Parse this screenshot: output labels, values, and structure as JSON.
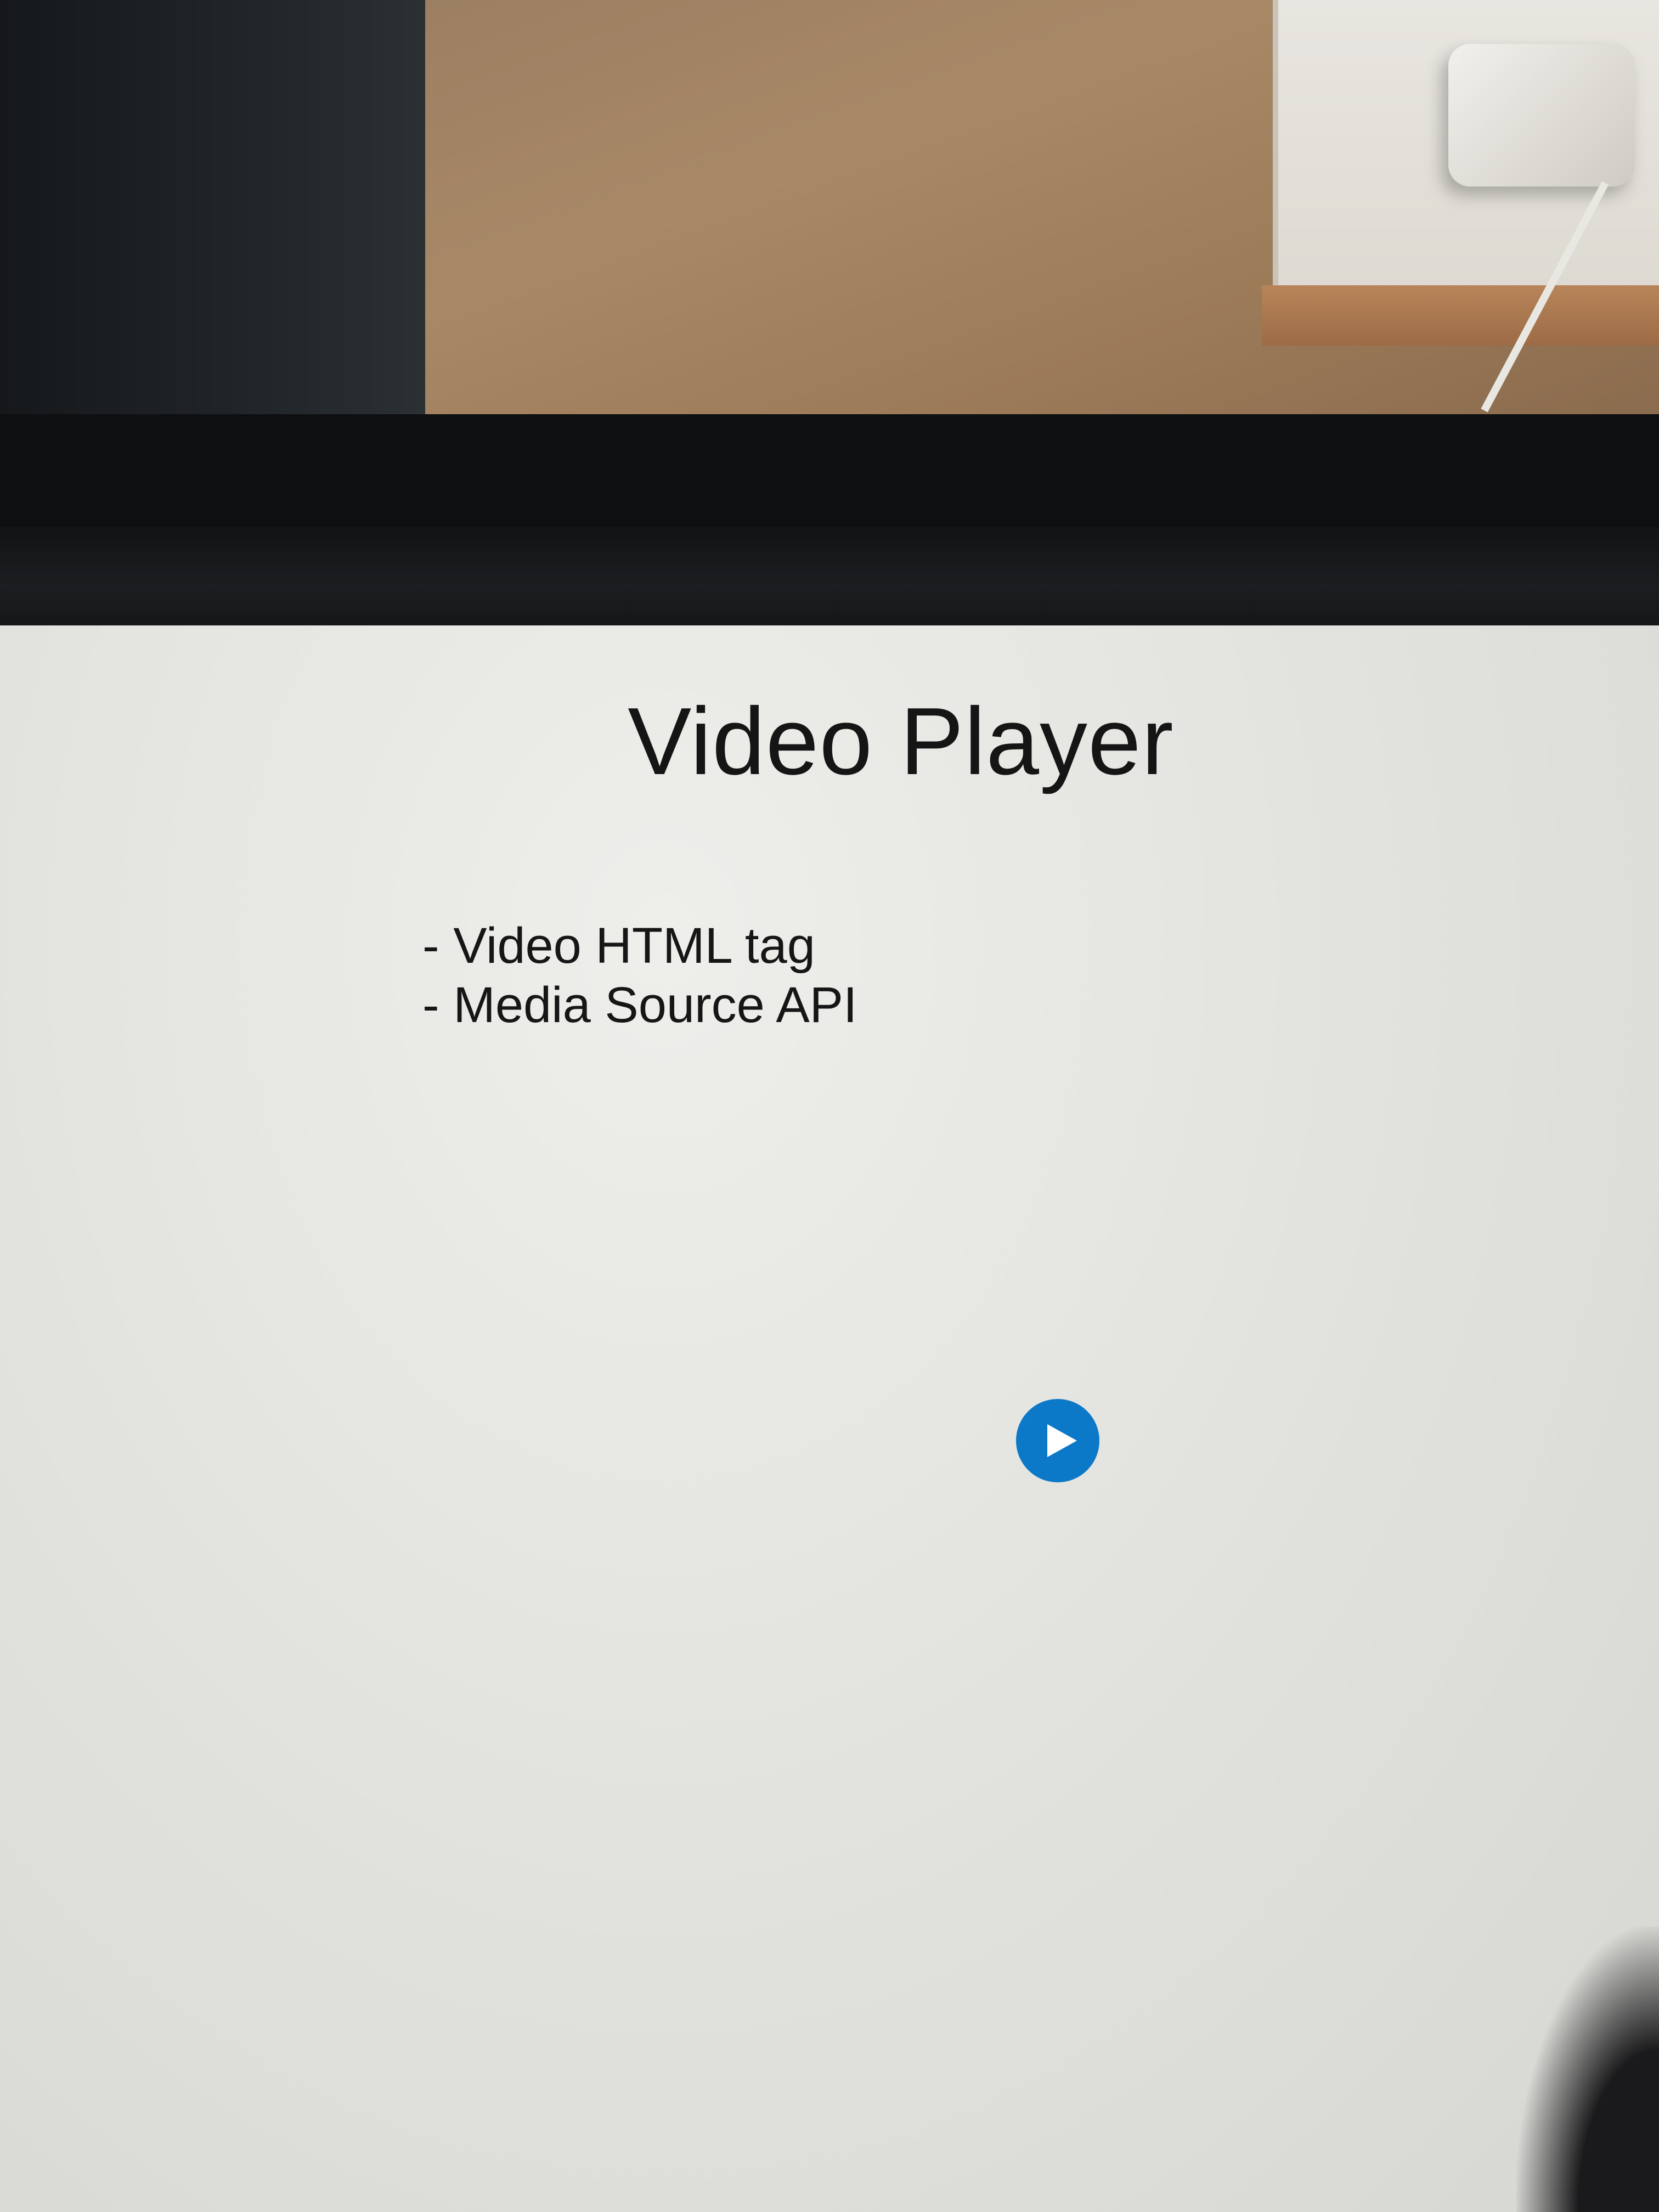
{
  "slide": {
    "title": "Video Player",
    "bullets": [
      "- Video HTML tag",
      "- Media Source API"
    ]
  },
  "player": {
    "play_icon": "play-icon",
    "accent_color": "#0b78c8"
  }
}
